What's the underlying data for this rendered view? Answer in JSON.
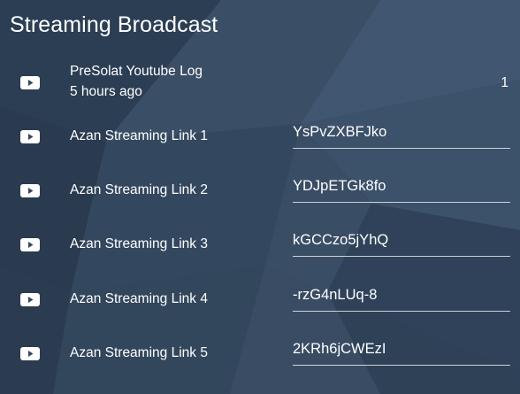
{
  "header": {
    "title": "Streaming Broadcast"
  },
  "log": {
    "label": "PreSolat Youtube Log",
    "time": "5 hours ago",
    "count": "1",
    "icon": "youtube-icon"
  },
  "links": [
    {
      "label": "Azan Streaming Link 1",
      "value": "YsPvZXBFJko",
      "icon": "youtube-icon"
    },
    {
      "label": "Azan Streaming Link 2",
      "value": "YDJpETGk8fo",
      "icon": "youtube-icon"
    },
    {
      "label": "Azan Streaming Link 3",
      "value": "kGCCzo5jYhQ",
      "icon": "youtube-icon"
    },
    {
      "label": "Azan Streaming Link 4",
      "value": "-rzG4nLUq-8",
      "icon": "youtube-icon"
    },
    {
      "label": "Azan Streaming Link 5",
      "value": "2KRh6jCWEzI",
      "icon": "youtube-icon"
    }
  ],
  "colors": {
    "background": "#34475e",
    "text": "#ffffff",
    "icon": "#ffffff"
  }
}
